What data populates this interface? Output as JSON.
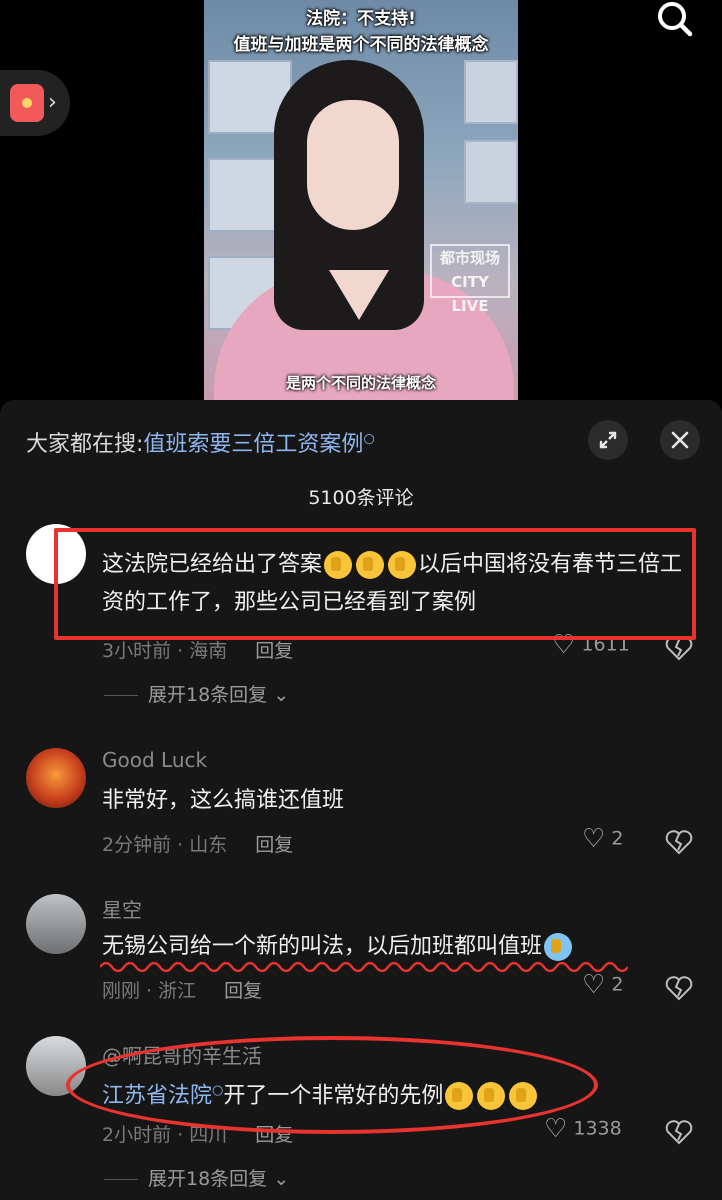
{
  "video": {
    "caption_line1": "法院：不支持!",
    "caption_line2": "值班与加班是两个不同的法律概念",
    "subtitle": "是两个不同的法律概念",
    "watermark": "都市现场 CITY LIVE"
  },
  "top_controls": {
    "search_icon": "search-icon",
    "red_packet_icon": "red-packet-icon"
  },
  "panel": {
    "hot_search_prefix": "大家都在搜:",
    "hot_search_query": "值班索要三倍工资案例",
    "comment_count": "5100条评论"
  },
  "comments": [
    {
      "name": "",
      "text_before": "这法院已经给出了答案",
      "text_after": "以后中国将没有春节三倍工资的工作了，那些公司已经看到了案例",
      "time": "3小时前 · 海南",
      "reply": "回复",
      "likes": "1611",
      "expand": "展开18条回复"
    },
    {
      "name": "Good Luck",
      "text": "非常好，这么搞谁还值班",
      "time": "2分钟前 · 山东",
      "reply": "回复",
      "likes": "2"
    },
    {
      "name": "星空",
      "text": "无锡公司给一个新的叫法，以后加班都叫值班",
      "time": "刚刚 · 浙江",
      "reply": "回复",
      "likes": "2"
    },
    {
      "name": "@啊昆哥的辛生活",
      "text_link": "江苏省法院",
      "text_after": "开了一个非常好的先例",
      "time": "2小时前 · 四川",
      "reply": "回复",
      "likes": "1338",
      "expand": "展开18条回复"
    }
  ],
  "colors": {
    "panel_bg": "#161616",
    "link": "#8fb7ef",
    "annotation_red": "#e8332f"
  }
}
